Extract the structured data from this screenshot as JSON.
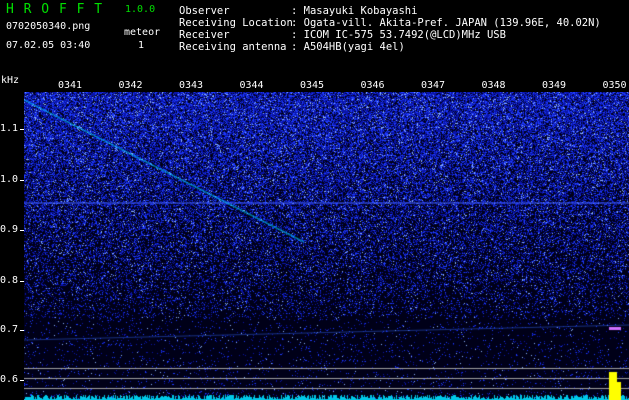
{
  "app": {
    "title": "H R O F F T",
    "version": "1.0.0",
    "filename": "0702050340.png",
    "meteor_label": "meteor",
    "meteor_count": "1",
    "datetime": "07.02.05 03:40"
  },
  "info": {
    "observer_label": "Observer",
    "observer_value": ": Masayuki Kobayashi",
    "location_label": "Receiving Location",
    "location_value": ": Ogata-vill. Akita-Pref. JAPAN (139.96E, 40.02N)",
    "receiver_label": "Receiver",
    "receiver_value": ": ICOM IC-575 53.7492(@LCD)MHz USB",
    "antenna_label": "Receiving antenna",
    "antenna_value": ": A504HB(yagi 4el)"
  },
  "axis": {
    "y_unit": "kHz",
    "y_ticks": [
      "1.1",
      "1.0",
      "0.9",
      "0.8",
      "0.7",
      "0.6"
    ],
    "x_ticks": [
      "0341",
      "0342",
      "0343",
      "0344",
      "0345",
      "0346",
      "0347",
      "0348",
      "0349",
      "0350"
    ]
  },
  "colors": {
    "title": "#00e000",
    "noise": "#2a3cff",
    "noise_bright": "#8fb4ff",
    "signal": "#00d8ff",
    "peak": "#ffff00"
  }
}
